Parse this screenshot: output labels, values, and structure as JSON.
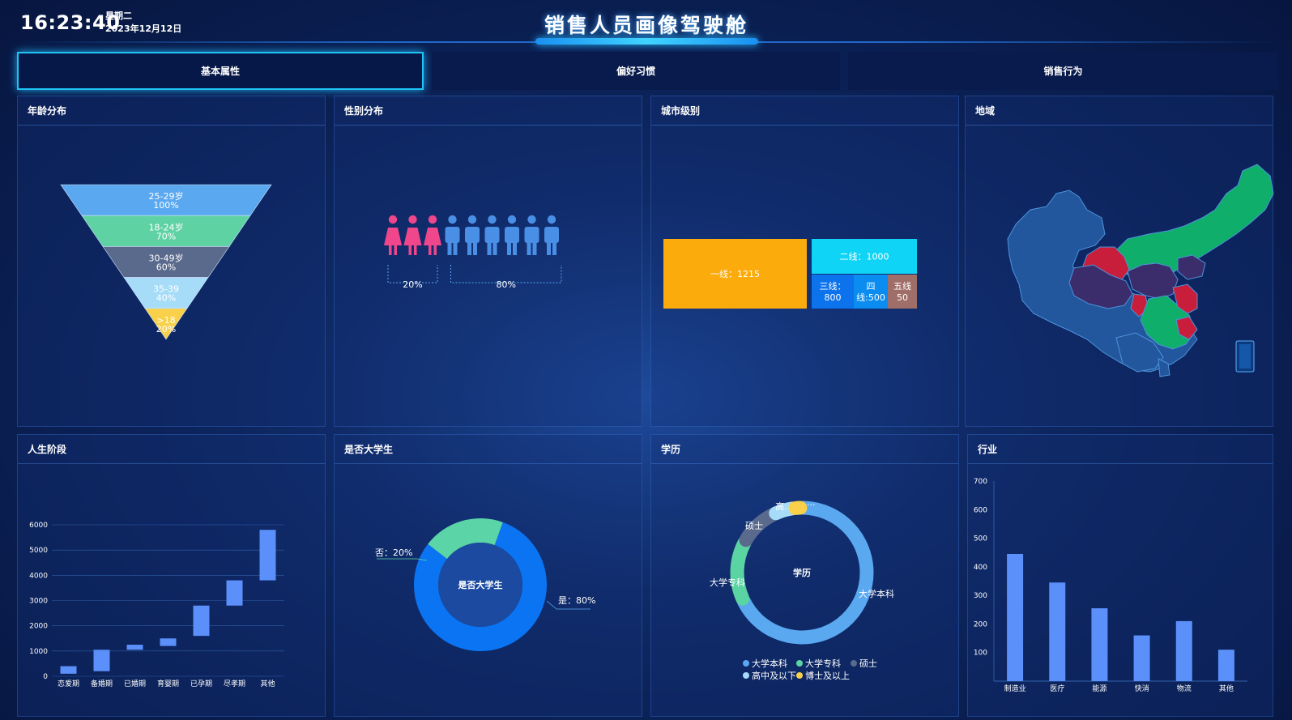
{
  "header": {
    "time": "16:23:40",
    "weekday": "星期二",
    "date": "2023年12月12日",
    "title": "销售人员画像驾驶舱"
  },
  "tabs": [
    {
      "label": "基本属性",
      "active": true
    },
    {
      "label": "偏好习惯",
      "active": false
    },
    {
      "label": "销售行为",
      "active": false
    }
  ],
  "panels": {
    "age": "年龄分布",
    "gender": "性别分布",
    "city": "城市级别",
    "region": "地域",
    "life": "人生阶段",
    "student": "是否大学生",
    "edu": "学历",
    "industry": "行业"
  },
  "colors": {
    "accent": "#1fc4f5",
    "bar": "#5b8ff9",
    "female": "#f0468c",
    "male": "#4a8fe6"
  },
  "chart_data": [
    {
      "id": "age",
      "type": "funnel",
      "items": [
        {
          "label": "25-29岁",
          "value": "100%",
          "color": "#5aa8f0"
        },
        {
          "label": "18-24岁",
          "value": "70%",
          "color": "#5fd2a4"
        },
        {
          "label": "30-49岁",
          "value": "60%",
          "color": "#5a6a8c"
        },
        {
          "label": "35-39",
          "value": "40%",
          "color": "#a6dcf8"
        },
        {
          "label": ">18",
          "value": "20%",
          "color": "#f8d04a"
        }
      ]
    },
    {
      "id": "gender",
      "type": "pictorial",
      "female_count": 3,
      "male_count": 6,
      "labels": [
        "20%",
        "80%"
      ]
    },
    {
      "id": "city",
      "type": "treemap",
      "items": [
        {
          "label": "一线：1215",
          "value": 1215,
          "color": "#fbab0c"
        },
        {
          "label": "二线：1000",
          "value": 1000,
          "color": "#10d4f6"
        },
        {
          "label": "三线：800",
          "lines": [
            "三线：",
            "800"
          ],
          "value": 800,
          "color": "#0c73ec"
        },
        {
          "label": "四线:500",
          "lines": [
            "四",
            "线:500"
          ],
          "value": 500,
          "color": "#0a8cf0"
        },
        {
          "label": "五线50",
          "lines": [
            "五线",
            "50"
          ],
          "value": 50,
          "color": "#a06e68"
        }
      ]
    },
    {
      "id": "life",
      "type": "bar",
      "subtype": "floating",
      "categories": [
        "恋爱期",
        "备婚期",
        "已婚期",
        "育婴期",
        "已孕期",
        "尽孝期",
        "其他"
      ],
      "ranges": [
        [
          100,
          400
        ],
        [
          200,
          1050
        ],
        [
          1050,
          1250
        ],
        [
          1200,
          1500
        ],
        [
          1600,
          2800
        ],
        [
          2800,
          3800
        ],
        [
          3800,
          5800
        ]
      ],
      "yticks": [
        0,
        1000,
        2000,
        3000,
        4000,
        5000,
        6000
      ],
      "ylim": [
        0,
        6000
      ]
    },
    {
      "id": "student",
      "type": "pie",
      "subtype": "donut",
      "center_label": "是否大学生",
      "slices": [
        {
          "label": "是：80%",
          "value": 80,
          "color": "#0b74f3"
        },
        {
          "label": "否：20%",
          "value": 20,
          "color": "#5bd4a8"
        }
      ]
    },
    {
      "id": "edu",
      "type": "pie",
      "subtype": "ring",
      "center_label": "学历",
      "slices": [
        {
          "name": "大学本科",
          "label": "大学本科",
          "value": 68,
          "color": "#5aa8f0"
        },
        {
          "name": "大学专科",
          "label": "大学专科",
          "value": 15,
          "color": "#5bd4a4"
        },
        {
          "name": "硕士",
          "label": "硕士",
          "value": 10,
          "color": "#5a6a8c"
        },
        {
          "name": "高中及以下",
          "label": "高...",
          "value": 5,
          "color": "#a6dcf8"
        },
        {
          "name": "博士及以上",
          "label": "...",
          "value": 2,
          "color": "#f8d04a"
        }
      ],
      "legend": [
        "大学本科",
        "大学专科",
        "硕士",
        "高中及以下",
        "博士及以上"
      ]
    },
    {
      "id": "industry",
      "type": "bar",
      "categories": [
        "制造业",
        "医疗",
        "能源",
        "快消",
        "物流",
        "其他"
      ],
      "values": [
        445,
        345,
        255,
        160,
        210,
        110
      ],
      "yticks": [
        100,
        200,
        300,
        400,
        500,
        600,
        700
      ],
      "ylim": [
        0,
        700
      ]
    }
  ]
}
